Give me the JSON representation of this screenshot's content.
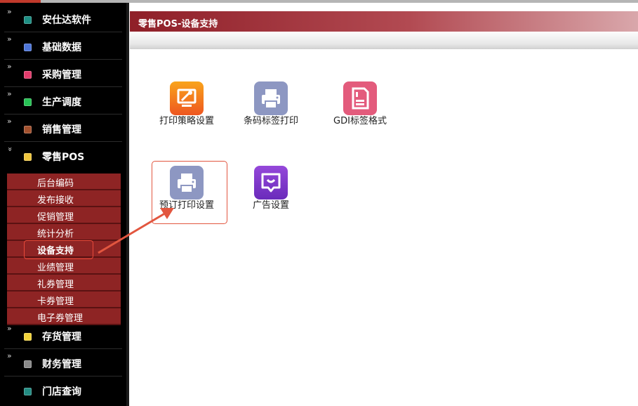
{
  "sidebar": {
    "items": [
      {
        "label": "安仕达软件",
        "icon": "teal-square-icon",
        "color": "#1e8f84"
      },
      {
        "label": "基础数据",
        "icon": "blue-square-icon",
        "color": "#4e76d8"
      },
      {
        "label": "采购管理",
        "icon": "pink-square-icon",
        "color": "#e23c6c"
      },
      {
        "label": "生产调度",
        "icon": "green-square-icon",
        "color": "#27c255"
      },
      {
        "label": "销售管理",
        "icon": "brown-square-icon",
        "color": "#a3512e"
      },
      {
        "label": "零售POS",
        "icon": "yellow-square-icon",
        "color": "#eec53d"
      },
      {
        "label": "存货管理",
        "icon": "yellow-square-icon",
        "color": "#f0d23a"
      },
      {
        "label": "财务管理",
        "icon": "gray-square-icon",
        "color": "#8a8a8a"
      },
      {
        "label": "门店查询",
        "icon": "teal-square-icon",
        "color": "#238c83"
      }
    ],
    "pos_submenu": [
      "后台编码",
      "发布接收",
      "促销管理",
      "统计分析",
      "设备支持",
      "业绩管理",
      "礼券管理",
      "卡券管理",
      "电子券管理"
    ],
    "active_sub": "设备支持"
  },
  "main": {
    "title": "零售POS-设备支持",
    "tiles": [
      {
        "label": "打印策略设置",
        "icon": "wrench-monitor-icon",
        "color": "#f06a1c"
      },
      {
        "label": "条码标签打印",
        "icon": "printer-icon",
        "color": "#8d97c2"
      },
      {
        "label": "GDI标签格式",
        "icon": "document-icon",
        "color": "#e35b7c"
      },
      {
        "label": "预订打印设置",
        "icon": "printer-icon",
        "color": "#8d97c2"
      },
      {
        "label": "广告设置",
        "icon": "display-icon",
        "color": "#7a35c7"
      }
    ]
  },
  "annotation_color": "#e2563f"
}
